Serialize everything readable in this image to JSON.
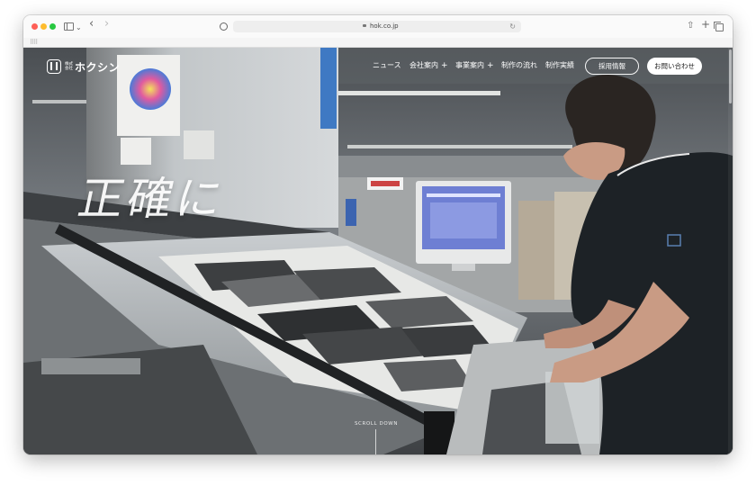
{
  "browser": {
    "address_url": "hok.co.jp",
    "icons": {
      "sidebar": "sidebar-icon",
      "back": "chevron-left-icon",
      "forward": "chevron-right-icon",
      "privacy": "shield-icon",
      "lock": "lock-icon",
      "reload": "reload-icon",
      "share": "share-icon",
      "new_tab": "plus-icon",
      "tab_overview": "tabs-icon"
    }
  },
  "site": {
    "logo": {
      "small_top": "株式",
      "small_bottom": "会社",
      "name": "ホクシン"
    },
    "nav": [
      {
        "label": "ニュース",
        "has_plus": false
      },
      {
        "label": "会社案内",
        "has_plus": true
      },
      {
        "label": "事業案内",
        "has_plus": true
      },
      {
        "label": "制作の流れ",
        "has_plus": false
      },
      {
        "label": "制作実績",
        "has_plus": false
      }
    ],
    "nav_plus": "+",
    "recruit_button": "採用情報",
    "contact_button": "お問い合わせ"
  },
  "hero": {
    "headline": "正確に",
    "scroll_label": "SCROLL DOWN"
  },
  "colors": {
    "header_text": "#ffffff",
    "contact_button_bg": "#ffffff",
    "contact_button_text": "#222222"
  }
}
